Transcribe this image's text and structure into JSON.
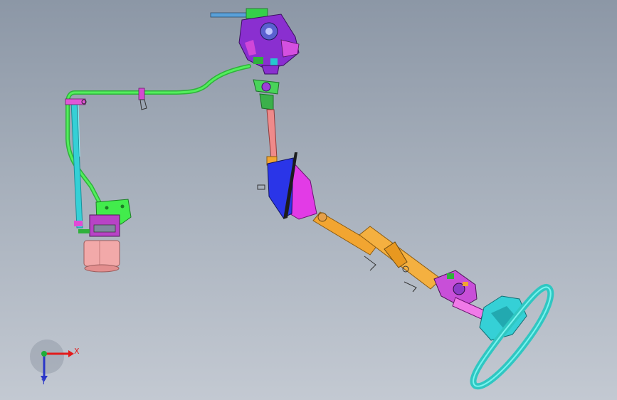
{
  "viewport": {
    "background_top": "#8c97a6",
    "background_bottom": "#c3c9d2"
  },
  "model": {
    "parts": [
      {
        "name": "hydraulic-pump-assembly",
        "color": "#9b2fd6"
      },
      {
        "name": "pressure-line",
        "color": "#3ee84a"
      },
      {
        "name": "return-line",
        "color": "#35d0d6"
      },
      {
        "name": "fluid-reservoir",
        "color": "#f0a7a7"
      },
      {
        "name": "reservoir-bracket",
        "color": "#3ee84a"
      },
      {
        "name": "intermediate-shaft",
        "color": "#f08080"
      },
      {
        "name": "dash-boot",
        "color": "#e23be6"
      },
      {
        "name": "dash-boot-flange",
        "color": "#2b34e8"
      },
      {
        "name": "steering-column",
        "color": "#f2a531"
      },
      {
        "name": "column-switch-assembly",
        "color": "#c84fd8"
      },
      {
        "name": "steering-wheel",
        "color": "#3ed8cf"
      }
    ]
  },
  "triad": {
    "x_label": "X",
    "y_label": "Y",
    "x_color": "#e21b1b",
    "y_color": "#2a36c8",
    "z_color": "#1fae3a"
  }
}
